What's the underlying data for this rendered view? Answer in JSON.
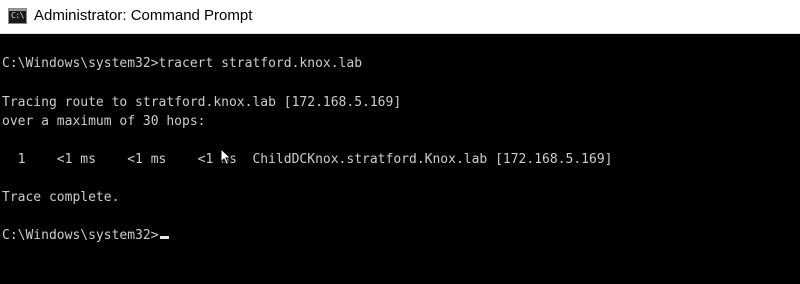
{
  "window": {
    "title": "Administrator: Command Prompt",
    "icon": "cmd-icon",
    "icon_glyph": "C:\\"
  },
  "console": {
    "lines": [
      "C:\\Windows\\system32>tracert stratford.knox.lab",
      "Tracing route to stratford.knox.lab [172.168.5.169]",
      "over a maximum of 30 hops:",
      "  1    <1 ms    <1 ms    <1 ms  ChildDCKnox.stratford.Knox.lab [172.168.5.169]",
      "Trace complete.",
      "C:\\Windows\\system32>"
    ]
  },
  "colors": {
    "console_background": "#000000",
    "console_text": "#cccccc",
    "titlebar_background": "#ffffff"
  },
  "pointer": "mouse-pointer-icon"
}
